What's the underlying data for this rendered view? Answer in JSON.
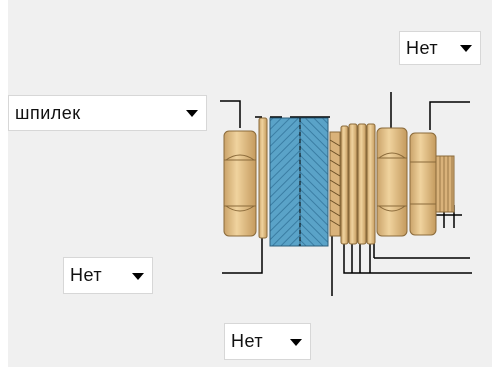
{
  "dropdowns": {
    "top_right": {
      "value": "Нет"
    },
    "left": {
      "value": "шпилек"
    },
    "bottom_left": {
      "value": "Нет"
    },
    "bottom_center": {
      "value": "Нет"
    }
  },
  "colors": {
    "panel_bg": "#f0f0f0",
    "nut_fill": "#e8c48c",
    "nut_stroke": "#8a6a3a",
    "plate_fill": "#5aa3c8",
    "plate_hatch": "#3a7da3",
    "line": "#000000"
  },
  "icons": {
    "dropdown_arrow": "chevron-down-icon"
  }
}
